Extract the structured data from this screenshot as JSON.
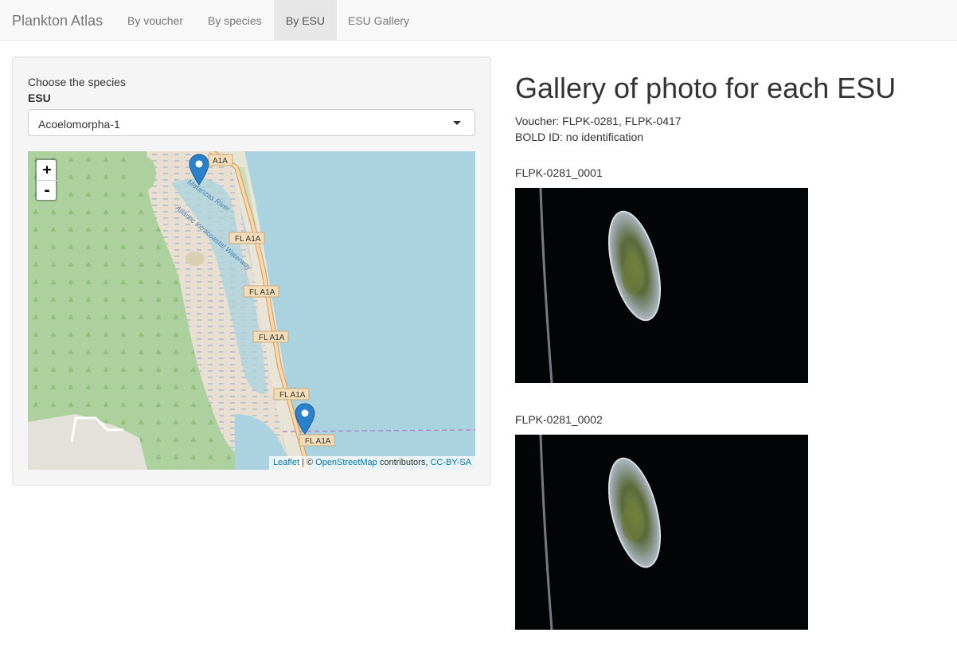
{
  "navbar": {
    "brand": "Plankton Atlas",
    "tabs": [
      {
        "label": "By voucher",
        "active": false
      },
      {
        "label": "By species",
        "active": false
      },
      {
        "label": "By ESU",
        "active": true
      },
      {
        "label": "ESU Gallery",
        "active": false
      }
    ]
  },
  "sidebar": {
    "choose_label": "Choose the species",
    "select_label": "ESU",
    "select_value": "Acoelomorpha-1",
    "caret_icon": "caret-down-icon"
  },
  "map": {
    "zoom_in": "+",
    "zoom_out": "-",
    "attribution": {
      "leaflet": "Leaflet",
      "sep": " | © ",
      "osm": "OpenStreetMap",
      "contributors": " contributors, ",
      "license": "CC-BY-SA"
    },
    "road_labels": [
      "A1A",
      "FL A1A",
      "FL A1A",
      "FL A1A",
      "FL A1A",
      "FL A1A"
    ],
    "water_labels": [
      "Matanzas River",
      "Atlantic Intracoastal Waterway"
    ],
    "marker_icon": "map-marker-icon",
    "colors": {
      "water": "#aad3df",
      "land": "#f2efe9",
      "forest": "#add19e",
      "marsh": "#e7e0d3",
      "road": "#fcd6a4",
      "marker": "#2a81cb"
    }
  },
  "main": {
    "title": "Gallery of photo for each ESU",
    "voucher": "Voucher: FLPK-0281, FLPK-0417",
    "bold_id": "BOLD ID: no identification",
    "photos": [
      {
        "label": "FLPK-0281_0001"
      },
      {
        "label": "FLPK-0281_0002"
      }
    ]
  }
}
